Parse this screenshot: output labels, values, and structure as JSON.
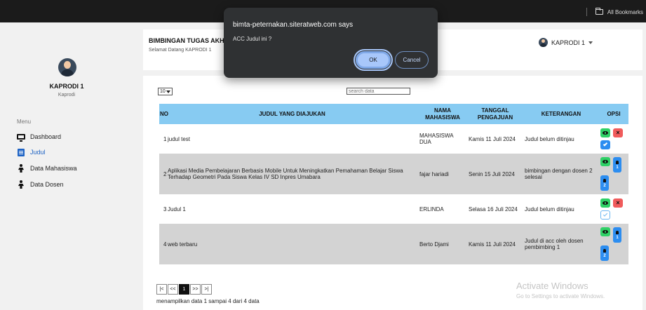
{
  "browser": {
    "bookmarks_label": "All Bookmarks"
  },
  "dialog": {
    "title": "bimta-peternakan.siteratweb.com says",
    "message": "ACC Judul ini ?",
    "ok_label": "OK",
    "cancel_label": "Cancel"
  },
  "sidebar": {
    "user_name": "KAPRODI 1",
    "user_role": "Kaprodi",
    "menu_title": "Menu",
    "items": [
      {
        "label": "Dashboard",
        "icon": "monitor-icon"
      },
      {
        "label": "Judul",
        "icon": "document-icon",
        "active": true
      },
      {
        "label": "Data Mahasiswa",
        "icon": "person-icon"
      },
      {
        "label": "Data Dosen",
        "icon": "person-icon"
      }
    ]
  },
  "header": {
    "title": "BIMBINGAN TUGAS AKHIR",
    "subtitle": "Selamat Datang KAPRODI 1",
    "user_menu_label": "KAPRODI 1"
  },
  "controls": {
    "per_page": "10",
    "search_placeholder": "search data"
  },
  "table": {
    "columns": [
      "NO",
      "JUDUL YANG DIAJUKAN",
      "NAMA MAHASISWA",
      "TANGGAL PENGAJUAN",
      "KETERANGAN",
      "OPSI"
    ],
    "rows": [
      {
        "no": "1",
        "judul": "judul test",
        "nama": "MAHASISWA DUA",
        "tanggal": "Kamis 11 Juli 2024",
        "keterangan": "Judul belum ditinjau"
      },
      {
        "no": "2",
        "judul": "Aplikasi Media Pembelajaran Berbasis Mobile Untuk Meningkatkan Pemahaman Belajar Siswa Terhadap Geometri Pada Siswa Kelas IV SD Inpres Umabara",
        "nama": "fajar hariadi",
        "tanggal": "Senin 15 Juli 2024",
        "keterangan": "bimbingan dengan dosen 2 selesai"
      },
      {
        "no": "3",
        "judul": "Judul 1",
        "nama": "ERLINDA",
        "tanggal": "Selasa 16 Juli 2024",
        "keterangan": "Judul belum ditinjau"
      },
      {
        "no": "4",
        "judul": "web terbaru",
        "nama": "Berto Djami",
        "tanggal": "Kamis 11 Juli 2024",
        "keterangan": "Judul di acc oleh dosen pembimbing 1"
      }
    ],
    "pin_labels": {
      "first": "1",
      "second": "2"
    }
  },
  "pagination": {
    "first": "|<",
    "prev": "<<",
    "current": "1",
    "next": ">>",
    "last": ">|",
    "info": "menampilkan data 1 sampai 4 dari 4 data"
  },
  "watermark": {
    "title": "Activate Windows",
    "subtitle": "Go to Settings to activate Windows."
  }
}
